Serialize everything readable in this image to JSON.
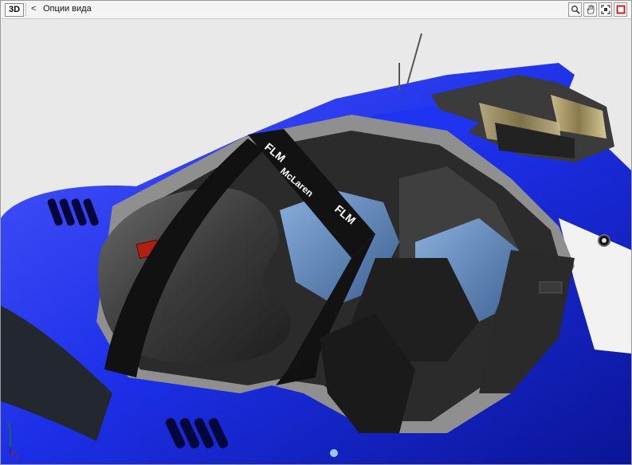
{
  "toolbar": {
    "mode_label": "3D",
    "back_label": "<",
    "view_options_label": "Опции вида"
  },
  "icons": {
    "zoom": "magnifier-icon",
    "pan": "hand-icon",
    "fit": "fit-frame-icon",
    "stop": "red-square-icon"
  },
  "scene": {
    "car_logo_text": [
      "FLM",
      "McLaren",
      "FLM"
    ]
  },
  "axis": {
    "y_label": "y",
    "x_label": "x"
  },
  "colors": {
    "body_blue": "#1c2fe6",
    "accent_red": "#cc1111"
  }
}
